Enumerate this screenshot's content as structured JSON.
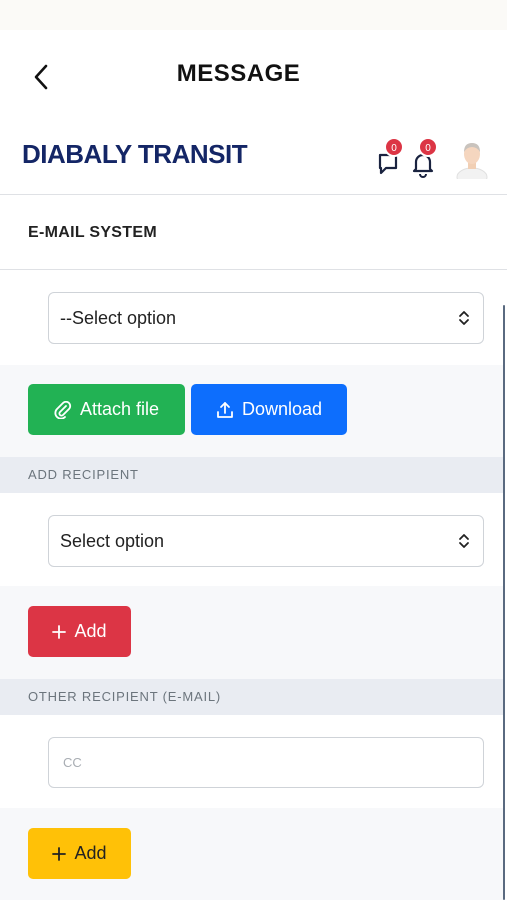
{
  "header": {
    "title": "MESSAGE",
    "brand": "DIABALY TRANSIT",
    "messages_count": "0",
    "notifications_count": "0"
  },
  "section": {
    "title": "E-MAIL SYSTEM"
  },
  "message_type": {
    "selected": "--Select option"
  },
  "actions": {
    "attach_label": "Attach file",
    "download_label": "Download"
  },
  "add_recipient": {
    "label": "ADD RECIPIENT",
    "selected": "Select option",
    "add_label": "Add"
  },
  "other_recipient": {
    "label": "OTHER RECIPIENT (E-MAIL)",
    "cc_placeholder": "CC",
    "add_label": "Add"
  },
  "colors": {
    "brand": "#142666",
    "green": "#22b254",
    "blue": "#0d6efd",
    "red": "#dc3545",
    "yellow": "#ffc107"
  }
}
